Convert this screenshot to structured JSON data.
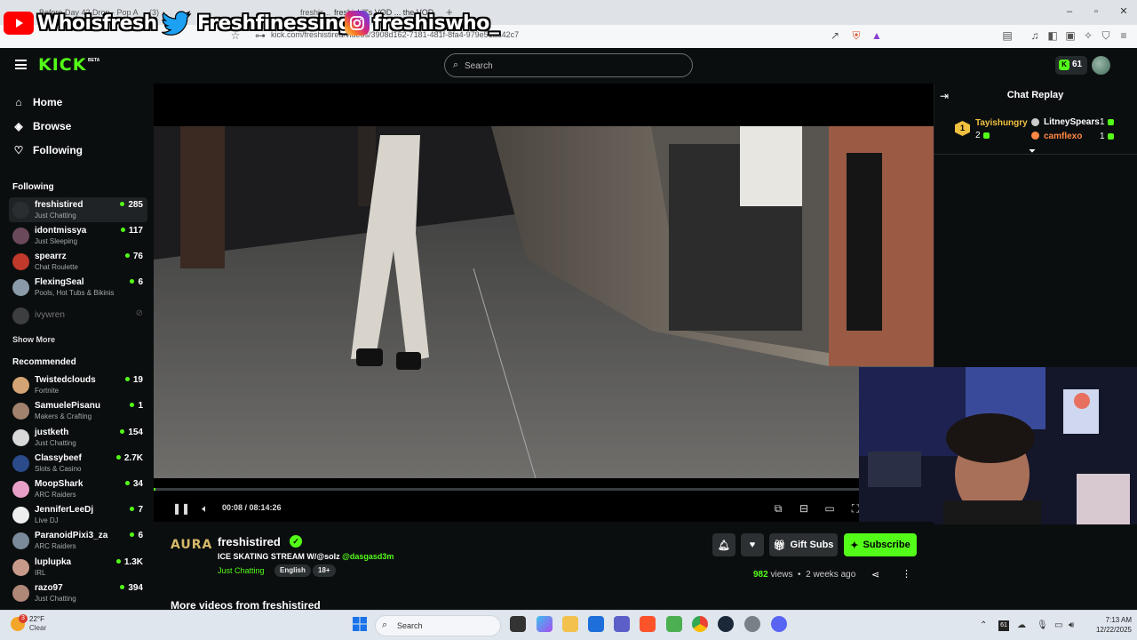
{
  "browser": {
    "tabs": [
      {
        "label": "Before Day 42 Drop - Pop Artest"
      },
      {
        "label": "(3) ..."
      },
      {
        "label": "freshis..."
      },
      {
        "label": "(3) ..."
      },
      {
        "label": "freshiskill's VOD ... the VOD"
      }
    ],
    "url": "kick.com/freshistired/videos/3908d162-7181-481f-8fa4-979e51aa42c7",
    "new_tab": "+"
  },
  "overlay": {
    "youtube": "Whoisfresh",
    "twitter": "Freshfinessing",
    "instagram": "freshiswho_"
  },
  "kick": {
    "logo": "KICK",
    "beta": "BETA",
    "search_placeholder": "Search",
    "points": "61"
  },
  "sidebar": {
    "nav": [
      {
        "label": "Home",
        "icon": "home-icon"
      },
      {
        "label": "Browse",
        "icon": "compass-icon"
      },
      {
        "label": "Following",
        "icon": "heart-icon"
      }
    ],
    "following_header": "Following",
    "following": [
      {
        "name": "freshistired",
        "category": "Just Chatting",
        "viewers": "285",
        "color": "#2a2e30"
      },
      {
        "name": "idontmissya",
        "category": "Just Sleeping",
        "viewers": "117",
        "color": "#6a4a5a"
      },
      {
        "name": "spearrz",
        "category": "Chat Roulette",
        "viewers": "76",
        "color": "#c0392b"
      },
      {
        "name": "FlexingSeal",
        "category": "Pools, Hot Tubs & Bikinis",
        "viewers": "6",
        "color": "#8a9aa8"
      },
      {
        "name": "ivywren",
        "category": "",
        "viewers": "",
        "color": "#888888"
      }
    ],
    "show_more": "Show More",
    "recommended_header": "Recommended",
    "recommended": [
      {
        "name": "Twistedclouds",
        "category": "Fortnite",
        "viewers": "19",
        "color": "#d4a574"
      },
      {
        "name": "SamuelePisanu",
        "category": "Makers & Crafting",
        "viewers": "1",
        "color": "#a0826d"
      },
      {
        "name": "justketh",
        "category": "Just Chatting",
        "viewers": "154",
        "color": "#d8d8d8"
      },
      {
        "name": "Classybeef",
        "category": "Slots & Casino",
        "viewers": "2.7K",
        "color": "#2a4a8a"
      },
      {
        "name": "MoopShark",
        "category": "ARC Raiders",
        "viewers": "34",
        "color": "#e8a0c8"
      },
      {
        "name": "JenniferLeeDj",
        "category": "Live DJ",
        "viewers": "7",
        "color": "#eeeeee"
      },
      {
        "name": "ParanoidPixi3_za",
        "category": "ARC Raiders",
        "viewers": "6",
        "color": "#7a8a9a"
      },
      {
        "name": "luplupka",
        "category": "IRL",
        "viewers": "1.3K",
        "color": "#c89a8a"
      },
      {
        "name": "razo97",
        "category": "Just Chatting",
        "viewers": "394",
        "color": "#b08878"
      }
    ]
  },
  "player": {
    "time": "00:08 / 08:14:26",
    "progress": 0.0003
  },
  "chat": {
    "title": "Chat Replay",
    "gifters": [
      {
        "name": "Tayishungry",
        "count": "2",
        "rank": "1",
        "color": "#f0c040"
      },
      {
        "name": "LitneySpears",
        "count": "1",
        "color": "#ffffff"
      },
      {
        "name": "camflexo",
        "count": "1",
        "color": "#ff8844"
      }
    ]
  },
  "stream": {
    "channel_logo": "AURA",
    "channel_name": "freshistired",
    "title": "ICE SKATING STREAM W/@solz",
    "mention": "@dasgasd3m",
    "category": "Just Chatting",
    "tags": [
      "English",
      "18+"
    ],
    "gift_subs": "Gift Subs",
    "subscribe": "Subscribe",
    "views_count": "982",
    "views_label": "views",
    "age": "2 weeks ago",
    "more_videos": "More videos from freshistired"
  },
  "taskbar": {
    "temp": "22°F",
    "condition": "Clear",
    "weather_badge": "3",
    "search_label": "Search",
    "time": "7:13 AM",
    "date": "12/22/2025"
  }
}
